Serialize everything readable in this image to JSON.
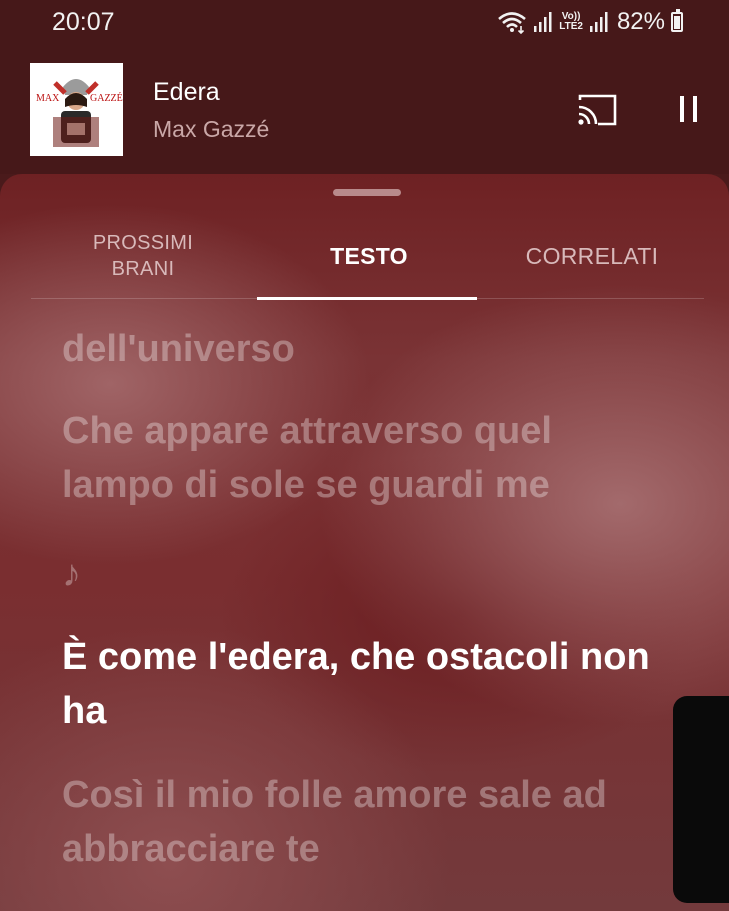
{
  "status_bar": {
    "time": "20:07",
    "network_label_top": "Vo))",
    "network_label_bottom": "LTE2",
    "battery": "82%",
    "battery_level": 0.82
  },
  "mini_player": {
    "album_art_text_left": "MAX",
    "album_art_text_right": "GAZZÉ",
    "title": "Edera",
    "artist": "Max Gazzé"
  },
  "tabs": [
    {
      "label": "PROSSIMI\nBRANI",
      "selected": false
    },
    {
      "label": "TESTO",
      "selected": true
    },
    {
      "label": "CORRELATI",
      "selected": false
    }
  ],
  "lyrics": {
    "lines": [
      "dell'universo",
      "Che appare attraverso quel lampo di sole se guardi me",
      "♪",
      "È come l'edera, che ostacoli non ha",
      "Così il mio folle amore sale ad abbracciare te"
    ],
    "active_index": 3
  },
  "colors": {
    "header_bg": "#461819",
    "sheet_bg": "#7a2e30",
    "active_lyric": "#ffffff",
    "inactive_lyric": "rgba(255,255,255,0.32)"
  }
}
